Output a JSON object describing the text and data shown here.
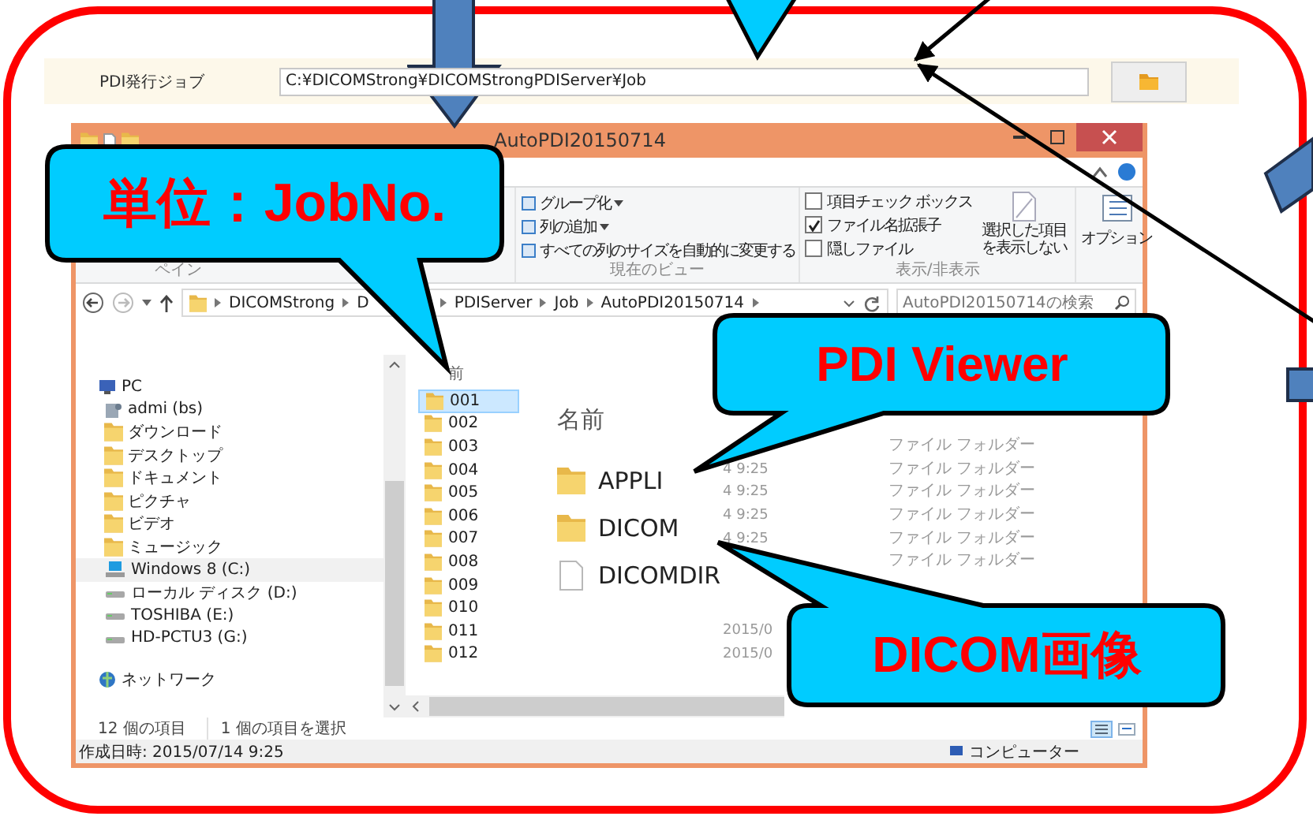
{
  "settings_row": {
    "label": "PDI発行ジョブ",
    "path": "C:¥DICOMStrong¥DICOMStrongPDIServer¥Job"
  },
  "explorer": {
    "title": "AutoPDI20150714",
    "ribbon": {
      "pane_label": "ペイン",
      "view_commands": [
        {
          "label": "グループ化",
          "dropdown": true
        },
        {
          "label": "列の追加",
          "dropdown": true
        },
        {
          "label": "すべての列のサイズを自動的に変更する",
          "dropdown": false
        }
      ],
      "view_label": "現在のビュー",
      "checkboxes": [
        {
          "label": "項目チェック ボックス",
          "checked": false
        },
        {
          "label": "ファイル名拡張子",
          "checked": true
        },
        {
          "label": "隠しファイル",
          "checked": false
        }
      ],
      "hide_selected": "選択した項目を表示しない",
      "show_hide_label": "表示/非表示",
      "options": "オプション"
    },
    "address": {
      "crumbs": [
        "DICOMStrong",
        "D",
        "PDIServer",
        "Job",
        "AutoPDI20150714"
      ],
      "search_placeholder": "AutoPDI20150714の検索"
    },
    "nav": [
      {
        "label": "PC",
        "kind": "pc",
        "selected": false,
        "children": [
          {
            "label": "admi (bs)",
            "kind": "user",
            "selected": false
          },
          {
            "label": "ダウンロード",
            "kind": "folder",
            "selected": false
          },
          {
            "label": "デスクトップ",
            "kind": "folder",
            "selected": false
          },
          {
            "label": "ドキュメント",
            "kind": "folder",
            "selected": false
          },
          {
            "label": "ピクチャ",
            "kind": "folder",
            "selected": false
          },
          {
            "label": "ビデオ",
            "kind": "folder",
            "selected": false
          },
          {
            "label": "ミュージック",
            "kind": "folder",
            "selected": false
          },
          {
            "label": "Windows 8 (C:)",
            "kind": "system",
            "selected": true
          },
          {
            "label": "ローカル ディスク (D:)",
            "kind": "drive",
            "selected": false
          },
          {
            "label": "TOSHIBA (E:)",
            "kind": "drive",
            "selected": false
          },
          {
            "label": "HD-PCTU3 (G:)",
            "kind": "drive",
            "selected": false
          }
        ]
      },
      {
        "label": "ネットワーク",
        "kind": "network",
        "selected": false
      }
    ],
    "list_header": "前",
    "rows": [
      {
        "name": "001",
        "selected": true
      },
      {
        "name": "002",
        "selected": false
      },
      {
        "name": "003",
        "selected": false,
        "type": "ファイル フォルダー"
      },
      {
        "name": "004",
        "selected": false,
        "date": "4 9:25",
        "type": "ファイル フォルダー"
      },
      {
        "name": "005",
        "selected": false,
        "date": "4 9:25",
        "type": "ファイル フォルダー"
      },
      {
        "name": "006",
        "selected": false,
        "date": "4 9:25",
        "type": "ファイル フォルダー"
      },
      {
        "name": "007",
        "selected": false,
        "date": "4 9:25",
        "type": "ファイル フォルダー"
      },
      {
        "name": "008",
        "selected": false,
        "type": "ファイル フォルダー"
      },
      {
        "name": "009",
        "selected": false
      },
      {
        "name": "010",
        "selected": false
      },
      {
        "name": "011",
        "selected": false,
        "date": "2015/0"
      },
      {
        "name": "012",
        "selected": false,
        "date": "2015/0"
      }
    ],
    "inset": {
      "header": "名前",
      "items": [
        {
          "name": "APPLI",
          "kind": "folder"
        },
        {
          "name": "DICOM",
          "kind": "folder"
        },
        {
          "name": "DICOMDIR",
          "kind": "file"
        }
      ]
    },
    "status": {
      "count": "12 個の項目",
      "selection": "1 個の項目を選択",
      "created": "作成日時: 2015/07/14 9:25",
      "location": "コンピューター"
    }
  },
  "callouts": [
    {
      "text": "単位：JobNo."
    },
    {
      "text": "PDI Viewer"
    },
    {
      "text": "DICOM画像"
    }
  ]
}
